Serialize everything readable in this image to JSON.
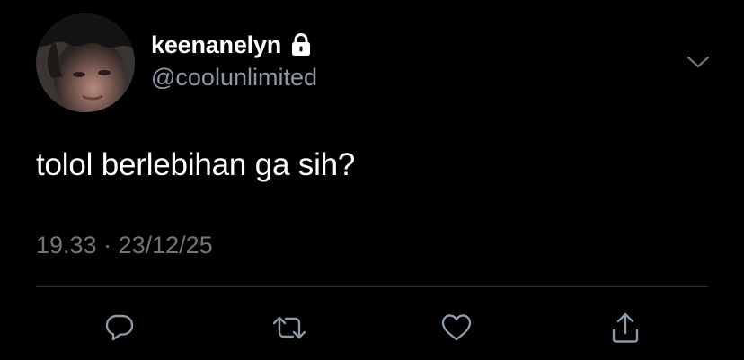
{
  "tweet": {
    "display_name": "keenanelyn",
    "handle": "@coolunlimited",
    "protected_icon": "lock-icon",
    "text": "tolol berlebihan ga sih?",
    "time": "19.33",
    "separator": "·",
    "date": "23/12/25",
    "menu_icon": "chevron-down-icon"
  },
  "actions": [
    {
      "name": "reply",
      "icon": "reply-icon"
    },
    {
      "name": "retweet",
      "icon": "retweet-icon"
    },
    {
      "name": "like",
      "icon": "heart-icon"
    },
    {
      "name": "share",
      "icon": "share-icon"
    }
  ],
  "colors": {
    "background": "#000000",
    "primary_text": "#ffffff",
    "secondary_text": "#6e767d",
    "handle_text": "#8b98a5",
    "divider": "#2f3336",
    "icon": "#8b98a5"
  }
}
